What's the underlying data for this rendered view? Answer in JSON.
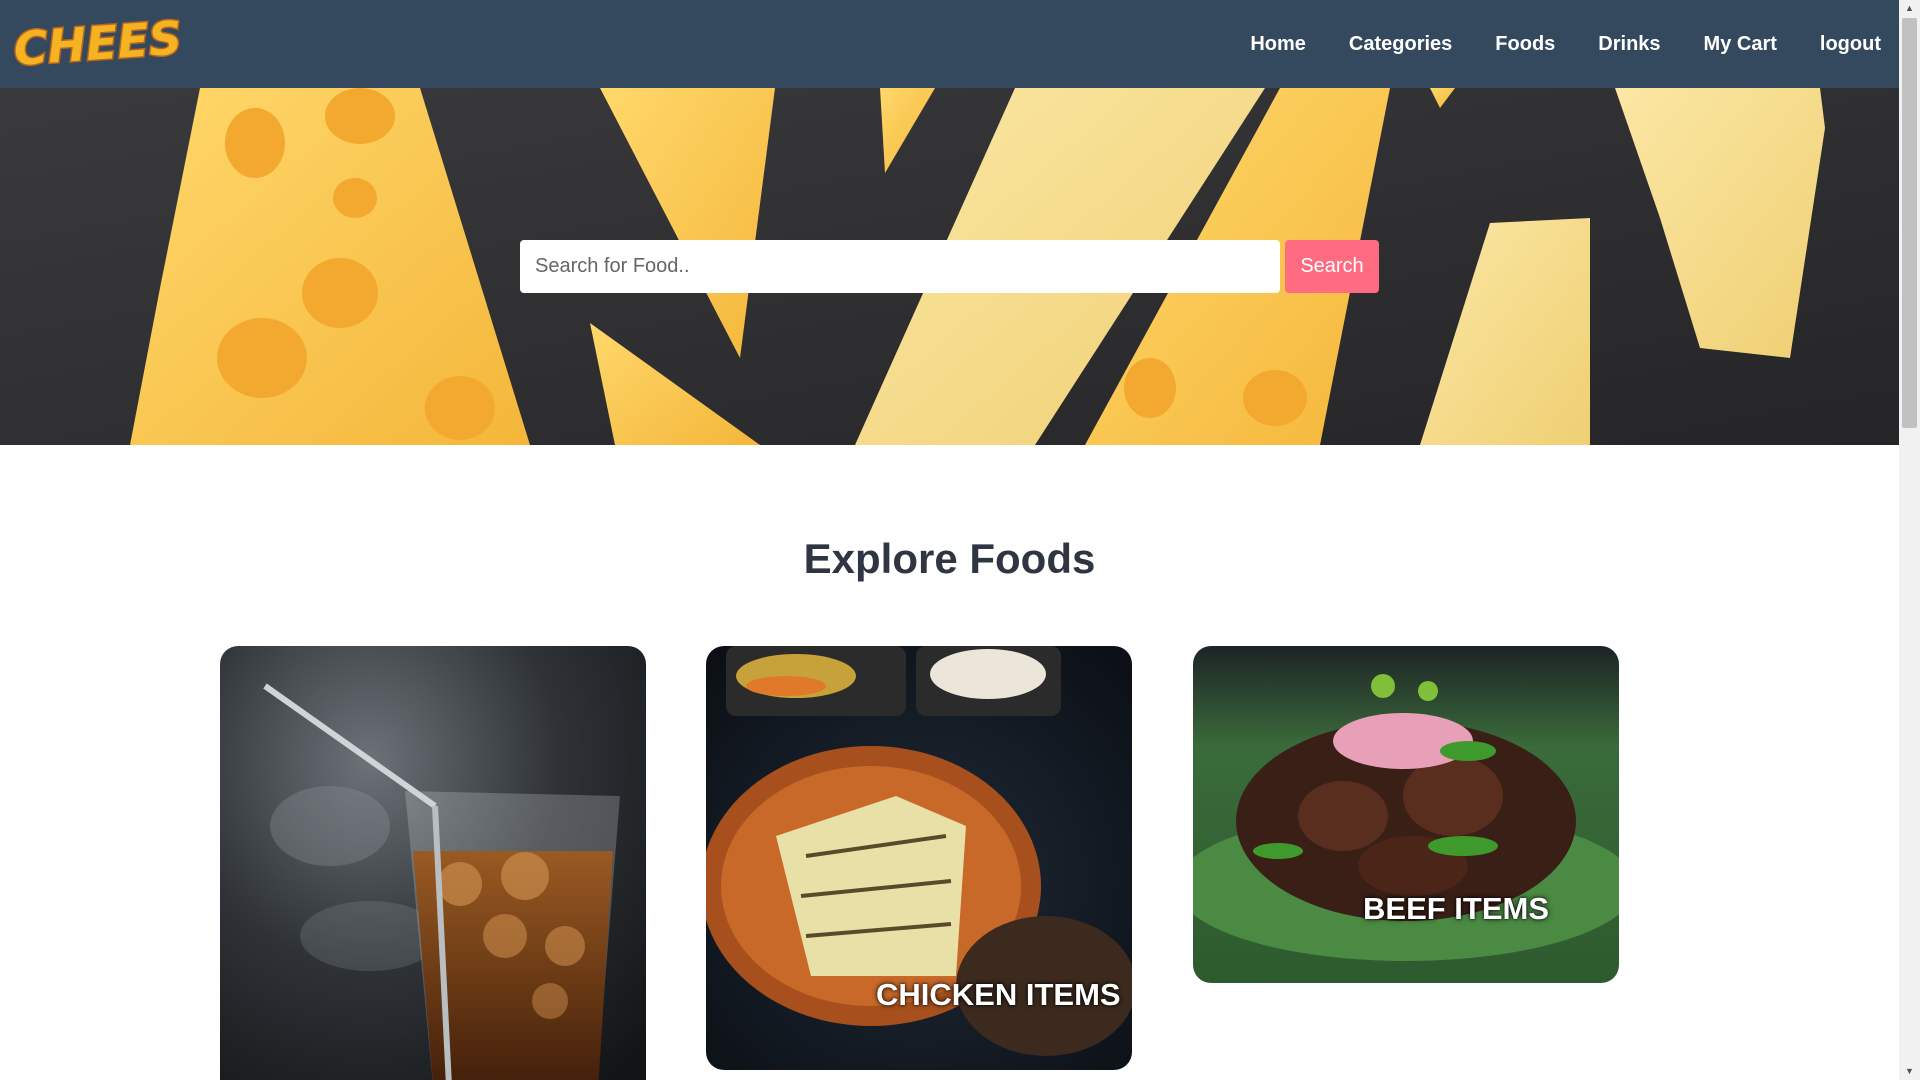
{
  "brand": {
    "logo_text": "CHEESY!"
  },
  "nav": {
    "items": [
      {
        "label": "Home"
      },
      {
        "label": "Categories"
      },
      {
        "label": "Foods"
      },
      {
        "label": "Drinks"
      },
      {
        "label": "My Cart"
      },
      {
        "label": "logout"
      }
    ]
  },
  "hero": {
    "search": {
      "placeholder": "Search for Food..",
      "value": ""
    },
    "search_button_label": "Search"
  },
  "explore": {
    "title": "Explore Foods",
    "cards": [
      {
        "label": "",
        "image": "iced-drink-image"
      },
      {
        "label": "CHICKEN ITEMS",
        "image": "chicken-cheese-image"
      },
      {
        "label": "BEEF ITEMS",
        "image": "beef-fry-image"
      }
    ]
  },
  "colors": {
    "navbar": "#34495e",
    "search_button": "#ff6b81",
    "title": "#2f3542"
  }
}
